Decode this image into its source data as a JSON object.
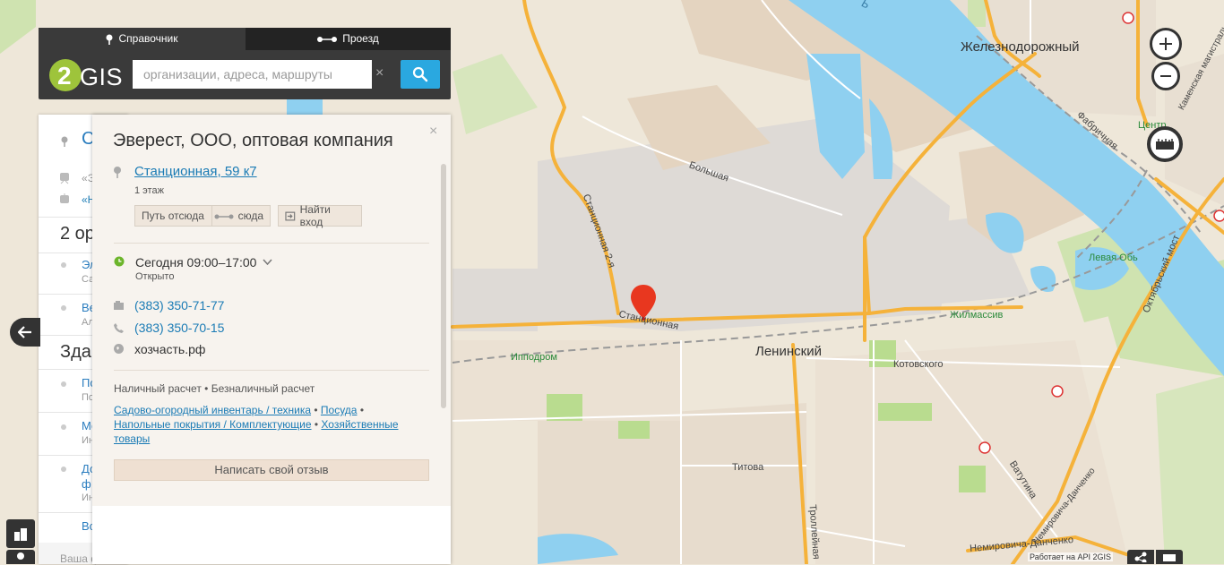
{
  "header": {
    "tabs": [
      {
        "label": "Справочник",
        "icon": "pin-icon"
      },
      {
        "label": "Проезд",
        "icon": "route-icon"
      }
    ],
    "logo_text": "2GIS",
    "search_placeholder": "организации, адреса, маршруты",
    "clear_symbol": "×"
  },
  "back_panel": {
    "first_item": "С",
    "line1": "«Э",
    "line2": "«Н",
    "heading1": "2 ор",
    "items1": [
      {
        "title": "Эл",
        "sub": "Са"
      },
      {
        "title": "Ве",
        "sub": "Ал"
      }
    ],
    "heading2": "Здан",
    "items2": [
      {
        "title": "По",
        "sub": "По"
      },
      {
        "title": "Мо",
        "sub": "Ин"
      },
      {
        "title": "До",
        "title2": "ф",
        "sub": "Ин"
      }
    ],
    "link": "Вс",
    "footer": "Ваша ф"
  },
  "card": {
    "title": "Эверест, ООО, оптовая компания",
    "address": "Станционная, 59 к7",
    "floor": "1 этаж",
    "btn_route_from": "Путь отсюда",
    "btn_route_to": "сюда",
    "btn_find_entrance": "Найти вход",
    "hours": "Сегодня 09:00–17:00",
    "status": "Открыто",
    "phone1": "(383) 350-71-77",
    "phone2": "(383) 350-70-15",
    "website": "хозчасть.рф",
    "payment": "Наличный расчет • Безналичный расчет",
    "categories": [
      "Садово-огородный инвентарь / техника",
      "Посуда",
      "Напольные покрытия / Комплектующие",
      "Хозяйственные товары"
    ],
    "review_button": "Написать свой отзыв",
    "close_symbol": "×"
  },
  "map": {
    "labels": {
      "zheleznodorozhny": "Железнодорожный",
      "leninsky": "Ленинский",
      "stantsionnaya": "Станционная",
      "stantsionnaya2": "Станционная 2-я",
      "bolshaya": "Большая",
      "ippodrom": "Ипподром",
      "zhilmassiv": "Жилмассив",
      "levaya_ob": "Левая Обь",
      "kotovskogo": "Котовского",
      "titova": "Титова",
      "troleynaya": "Троллейная",
      "vatutina": "Ватутина",
      "nemirovicha": "Немировича-Данченко",
      "oktyabrsky_most": "Октябрьский мост",
      "fabrichnaya": "Фабричная",
      "tsentr": "Центр",
      "kamenskaya": "Каменская магистраль",
      "river_partial": "Ъ"
    },
    "credit": "Работает на API 2GIS"
  },
  "colors": {
    "header_bg": "#3a3a3a",
    "search_button": "#2aa8e0",
    "link": "#1a7bb5",
    "marker": "#e8371f",
    "water": "#8fd0f0",
    "main_road": "#f5b23a",
    "open_status": "#6cb52b"
  }
}
